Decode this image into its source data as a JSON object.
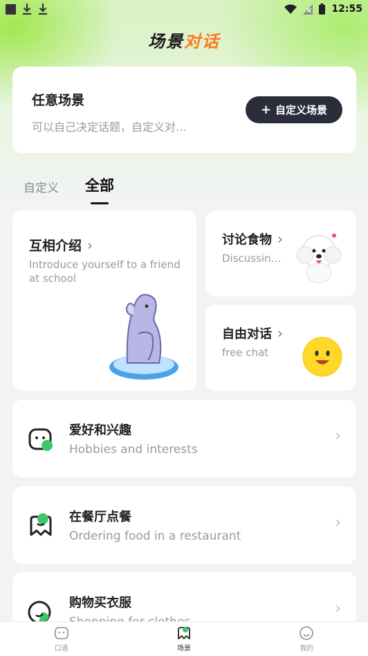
{
  "status_bar": {
    "time": "12:55"
  },
  "header": {
    "title_part1": "场景",
    "title_part2": "对话"
  },
  "any_scene": {
    "title": "任意场景",
    "subtitle": "可以自己决定话题，自定义对…",
    "button_label": "自定义场景"
  },
  "tabs": [
    {
      "label": "自定义",
      "active": false
    },
    {
      "label": "全部",
      "active": true
    }
  ],
  "featured": {
    "intro": {
      "title": "互相介绍",
      "subtitle": "Introduce yourself to a friend at school"
    },
    "food": {
      "title": "讨论食物",
      "subtitle": "Discussing food"
    },
    "free": {
      "title": "自由对话",
      "subtitle": "free chat"
    }
  },
  "scenes": [
    {
      "title": "爱好和兴趣",
      "subtitle": "Hobbies and interests",
      "icon": "chat-face-icon"
    },
    {
      "title": "在餐厅点餐",
      "subtitle": "Ordering food in a restaurant",
      "icon": "dining-icon"
    },
    {
      "title": "购物买衣服",
      "subtitle": "Shopping for clothes",
      "icon": "shopping-icon"
    }
  ],
  "bottom_nav": [
    {
      "label": "口语",
      "icon": "speaking-icon",
      "active": false
    },
    {
      "label": "场景",
      "icon": "scene-icon",
      "active": true
    },
    {
      "label": "我的",
      "icon": "profile-icon",
      "active": false
    }
  ],
  "colors": {
    "accent_green": "#3ec66a",
    "button_dark": "#2b2d3a",
    "title_orange": "#ff7a1a"
  }
}
